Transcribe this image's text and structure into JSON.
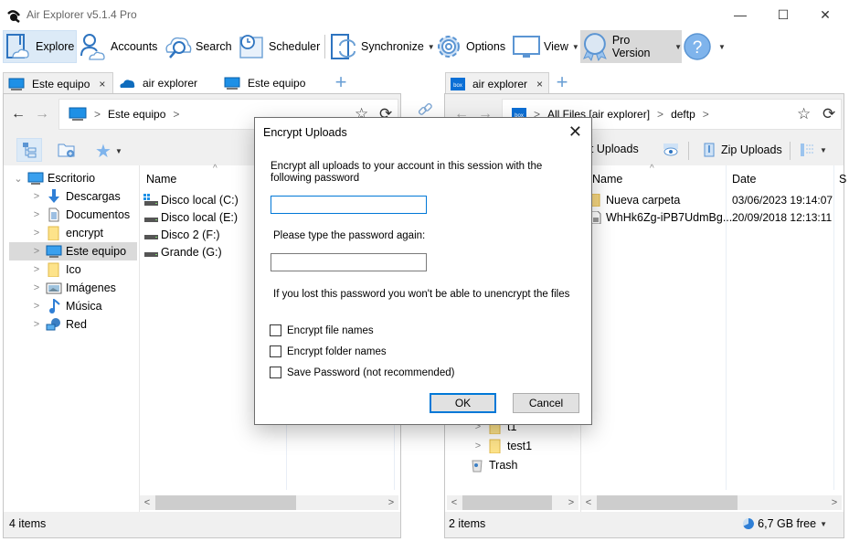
{
  "window": {
    "title": "Air Explorer v5.1.4 Pro",
    "controls": {
      "minimize": "—",
      "maximize": "☐",
      "close": "✕"
    }
  },
  "toolbar": {
    "items": [
      {
        "label": "Explore",
        "icon": "explore-icon",
        "active": true
      },
      {
        "label": "Accounts",
        "icon": "accounts-icon"
      },
      {
        "label": "Search",
        "icon": "cloud-search-icon"
      },
      {
        "label": "Scheduler",
        "icon": "calendar-clock-icon"
      },
      {
        "label": "Synchronize",
        "icon": "sync-icon",
        "dropdown": true
      },
      {
        "label": "Options",
        "icon": "gear-icon"
      },
      {
        "label": "View",
        "icon": "monitor-icon",
        "dropdown": true
      },
      {
        "label": "Pro Version",
        "icon": "award-badge-icon",
        "dropdown": true,
        "highlighted": true
      },
      {
        "label": "?",
        "icon": "help-icon",
        "dropdown": true
      }
    ],
    "caret": "▼"
  },
  "left_pane": {
    "tabs": [
      {
        "label": "Este equipo",
        "icon": "computer-icon",
        "active": true,
        "close": "×"
      },
      {
        "label": "air explorer",
        "icon": "onedrive-icon"
      },
      {
        "label": "Este equipo",
        "icon": "computer-icon"
      }
    ],
    "add_tab": "+",
    "nav": {
      "back": "←",
      "forward": "→",
      "breadcrumb": [
        "Este equipo"
      ],
      "chevron": ">",
      "star": "☆",
      "refresh": "⟳"
    },
    "tree": [
      {
        "label": "Escritorio",
        "icon": "desktop-icon",
        "expand": "⌄",
        "level": 0
      },
      {
        "label": "Descargas",
        "icon": "download-arrow-icon",
        "expand": ">",
        "level": 1
      },
      {
        "label": "Documentos",
        "icon": "document-icon",
        "expand": ">",
        "level": 1
      },
      {
        "label": "encrypt",
        "icon": "folder-icon",
        "expand": ">",
        "level": 1
      },
      {
        "label": "Este equipo",
        "icon": "computer-icon",
        "expand": ">",
        "level": 1,
        "selected": true
      },
      {
        "label": "Ico",
        "icon": "folder-icon",
        "expand": ">",
        "level": 1
      },
      {
        "label": "Imágenes",
        "icon": "pictures-icon",
        "expand": ">",
        "level": 1
      },
      {
        "label": "Música",
        "icon": "music-note-icon",
        "expand": ">",
        "level": 1
      },
      {
        "label": "Red",
        "icon": "network-icon",
        "expand": ">",
        "level": 1
      }
    ],
    "columns": [
      "Name"
    ],
    "sort_indicator": "^",
    "files": [
      {
        "name": "Disco local (C:)",
        "icon": "windows-drive-icon"
      },
      {
        "name": "Disco local (E:)",
        "icon": "drive-icon"
      },
      {
        "name": "Disco 2 (F:)",
        "icon": "drive-icon"
      },
      {
        "name": "Grande (G:)",
        "icon": "drive-icon"
      }
    ],
    "status": "4 items",
    "scroll": {
      "left": "<",
      "right": ">"
    }
  },
  "right_pane": {
    "tabs": [
      {
        "label": "air explorer",
        "icon": "box-icon",
        "active": true,
        "close": "×"
      }
    ],
    "add_tab": "+",
    "nav": {
      "back": "←",
      "forward": "→",
      "breadcrumb": [
        "All Files [air explorer]",
        "deftp"
      ],
      "chevron": ">",
      "star": "☆",
      "refresh": "⟳",
      "box_label": "box"
    },
    "toolbar": {
      "encrypt_uploads": "Encrypt Uploads",
      "zip_uploads": "Zip Uploads"
    },
    "tree": [
      {
        "label": "t1",
        "icon": "folder-icon",
        "expand": ">"
      },
      {
        "label": "test1",
        "icon": "folder-icon",
        "expand": ">"
      },
      {
        "label": "Trash",
        "icon": "trash-icon"
      }
    ],
    "columns": [
      "Name",
      "Date",
      "S"
    ],
    "sort_indicator": "^",
    "files": [
      {
        "name": "Nueva carpeta",
        "date": "03/06/2023 19:14:07",
        "icon": "folder-icon"
      },
      {
        "name": "WhHk6Zg-iPB7UdmBg...",
        "date": "20/09/2018 12:13:11",
        "icon": "file-icon"
      }
    ],
    "status": "2 items",
    "free_space": "6,7 GB free",
    "scroll": {
      "left": "<",
      "right": ">"
    }
  },
  "dialog": {
    "title": "Encrypt Uploads",
    "close": "✕",
    "instruction": "Encrypt all uploads to your account in this session with the following password",
    "password_value": "",
    "confirm_label": "Please type the password again:",
    "confirm_value": "",
    "warning": "If you lost this password you won't be able to unencrypt the files",
    "checkboxes": [
      {
        "label": "Encrypt file names",
        "checked": false
      },
      {
        "label": "Encrypt folder names",
        "checked": false
      },
      {
        "label": "Save Password (not recommended)",
        "checked": false
      }
    ],
    "ok": "OK",
    "cancel": "Cancel"
  }
}
